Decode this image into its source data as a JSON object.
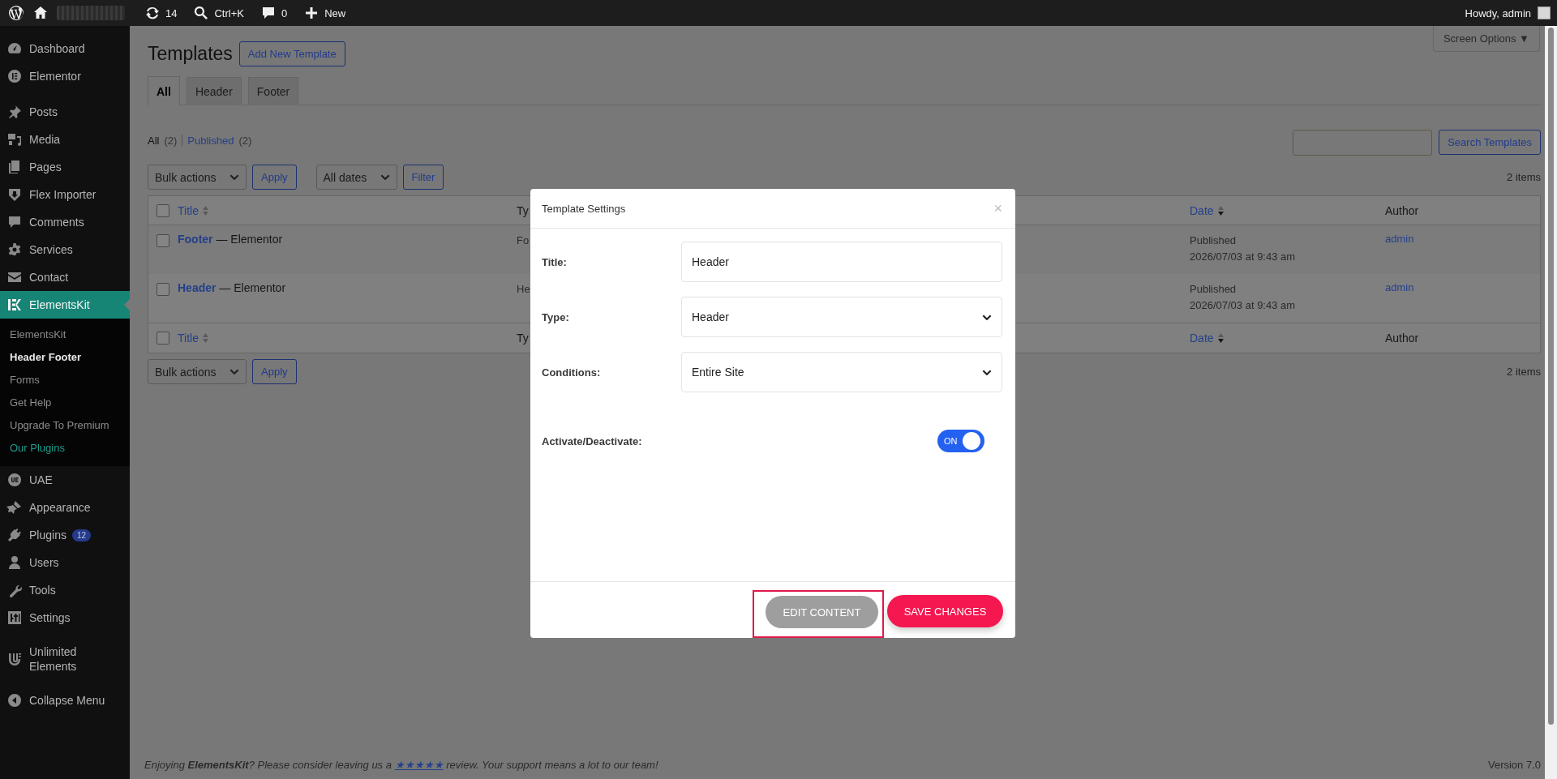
{
  "topbar": {
    "updates": "14",
    "search_shortcut": "Ctrl+K",
    "comments": "0",
    "new": "New",
    "greeting": "Howdy, admin"
  },
  "sidebar": {
    "groups": [
      [
        {
          "label": "Dashboard",
          "current": false
        },
        {
          "label": "Elementor",
          "current": false
        }
      ],
      [
        {
          "label": "Posts",
          "current": false
        },
        {
          "label": "Media",
          "current": false
        },
        {
          "label": "Pages",
          "current": false
        },
        {
          "label": "Flex Importer",
          "current": false
        },
        {
          "label": "Comments",
          "current": false
        },
        {
          "label": "Services",
          "current": false
        },
        {
          "label": "Contact",
          "current": false
        },
        {
          "label": "ElementsKit",
          "current": true,
          "children": [
            {
              "label": "ElementsKit",
              "current": false
            },
            {
              "label": "Header Footer",
              "current": true
            },
            {
              "label": "Forms",
              "current": false
            },
            {
              "label": "Get Help",
              "current": false
            },
            {
              "label": "Upgrade To Premium",
              "current": false
            },
            {
              "label": "Our Plugins",
              "current": false,
              "color": "#1f9c8e"
            }
          ]
        },
        {
          "label": "UAE",
          "current": false
        },
        {
          "label": "Appearance",
          "current": false
        },
        {
          "label": "Plugins",
          "current": false,
          "badge": "12"
        },
        {
          "label": "Users",
          "current": false
        },
        {
          "label": "Tools",
          "current": false
        },
        {
          "label": "Settings",
          "current": false
        }
      ],
      [
        {
          "label": "Unlimited Elements",
          "current": false
        }
      ]
    ],
    "collapse": "Collapse Menu"
  },
  "screen_options": "Screen Options ▼",
  "page_title": "Templates",
  "add_new": "Add New Template",
  "tabs": [
    {
      "label": "All",
      "selected": true
    },
    {
      "label": "Header",
      "selected": false
    },
    {
      "label": "Footer",
      "selected": false
    }
  ],
  "views": [
    {
      "label": "All",
      "count": "(2)",
      "selected": true
    },
    {
      "label": "Published",
      "count": "(2)",
      "selected": false
    }
  ],
  "search_button": "Search Templates",
  "bulk_actions": "Bulk actions",
  "apply": "Apply",
  "date_filter": "All dates",
  "filter": "Filter",
  "items_count": "2 items",
  "table": {
    "select_all_checked": false,
    "footer_select_all_checked": false,
    "columns": [
      {
        "label": "Title",
        "sorted": false
      },
      {
        "label": "Ty"
      },
      {
        "label": "Date",
        "sorted": true
      },
      {
        "label": "Author"
      }
    ],
    "rows": [
      {
        "title": "Footer",
        "state": "— Elementor",
        "type": "Fo",
        "status": "Published",
        "date": "2026/07/03 at 9:43 am",
        "author": "admin",
        "checked": false
      },
      {
        "title": "Header",
        "state": "— Elementor",
        "type": "He",
        "status": "Published",
        "date": "2026/07/03 at 9:43 am",
        "author": "admin",
        "checked": false
      }
    ],
    "footer_columns": [
      {
        "label": "Title",
        "sorted": false
      },
      {
        "label": "Ty"
      },
      {
        "label": "Date",
        "sorted": true
      },
      {
        "label": "Author"
      }
    ]
  },
  "bottom_bulk_actions": "Bulk actions",
  "bottom_apply": "Apply",
  "bottom_items_count": "2 items",
  "footer_note": {
    "before": "Enjoying **ElementsKit**? Please consider leaving us a",
    "link": "★★★★★",
    "after": "review. Your support means a lot to our team!"
  },
  "version": "Version 7.0",
  "modal": {
    "title": "Template Settings",
    "close": "×",
    "fields": [
      {
        "kind": "text",
        "label": "Title:",
        "value": "Header"
      },
      {
        "kind": "select",
        "label": "Type:",
        "value": "Header"
      },
      {
        "kind": "select",
        "label": "Conditions:",
        "value": "Entire Site"
      }
    ],
    "toggle": {
      "label": "Activate/Deactivate:",
      "on": true,
      "text": "ON"
    },
    "edit_button": {
      "label": "EDIT CONTENT",
      "highlighted": true
    },
    "save_button": "SAVE CHANGES"
  }
}
